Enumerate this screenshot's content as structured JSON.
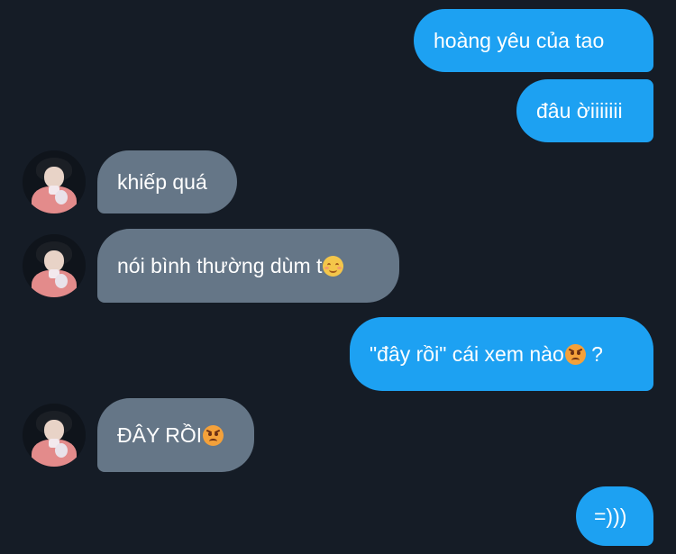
{
  "messages": [
    {
      "dir": "out",
      "text": "hoàng yêu của tao"
    },
    {
      "dir": "out",
      "text": "đâu ờiiiiiii"
    },
    {
      "dir": "in",
      "text": "khiếp quá"
    },
    {
      "dir": "in",
      "text": "nói bình thường dùm t",
      "emoji": "relieved-face-emoji"
    },
    {
      "dir": "out",
      "text": "\"đây rồi\" cái xem nào",
      "emoji": "angry-face-emoji",
      "suffix": " ?"
    },
    {
      "dir": "in",
      "text": "ĐÂY RỒI",
      "emoji": "angry-face-emoji"
    },
    {
      "dir": "out",
      "text": "=)))"
    }
  ],
  "colors": {
    "background": "#151c26",
    "outgoing_bubble": "#1da1f2",
    "incoming_bubble": "#657687",
    "text": "#ffffff"
  },
  "avatar": {
    "icon": "user-avatar-photo"
  }
}
